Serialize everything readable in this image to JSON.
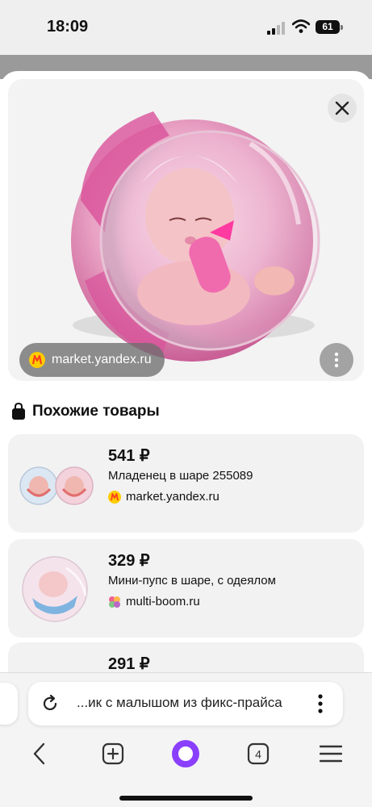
{
  "status": {
    "time": "18:09",
    "battery": "61",
    "icons": [
      "signal-icon",
      "wifi-icon",
      "battery-icon"
    ]
  },
  "hero": {
    "image": "doll-in-ball-photo",
    "source_label": "market.yandex.ru",
    "close_icon": "close-icon",
    "more_icon": "more-vertical-icon"
  },
  "similar": {
    "title": "Похожие товары",
    "icon": "shopping-bag-icon",
    "items": [
      {
        "price": "541 ₽",
        "name": "Младенец в шаре 255089",
        "source": "market.yandex.ru",
        "source_icon": "yandex-market-icon"
      },
      {
        "price": "329 ₽",
        "name": "Мини-пупс в шаре, с одеялом",
        "source": "multi-boom.ru",
        "source_icon": "multi-boom-icon"
      },
      {
        "price": "291 ₽",
        "name": "",
        "source": "",
        "source_icon": ""
      }
    ]
  },
  "browser": {
    "url_text": "...ик с малышом из фикс-прайса",
    "tabs_count": "4",
    "nav_icons": [
      "back-icon",
      "new-tab-icon",
      "alice-icon",
      "tabs-icon",
      "menu-icon"
    ]
  },
  "colors": {
    "yandex_red": "#fc3f1d",
    "yandex_yellow": "#ffcc00",
    "alice_purple": "#8a3ffc",
    "card_bg": "#f2f2f2"
  }
}
